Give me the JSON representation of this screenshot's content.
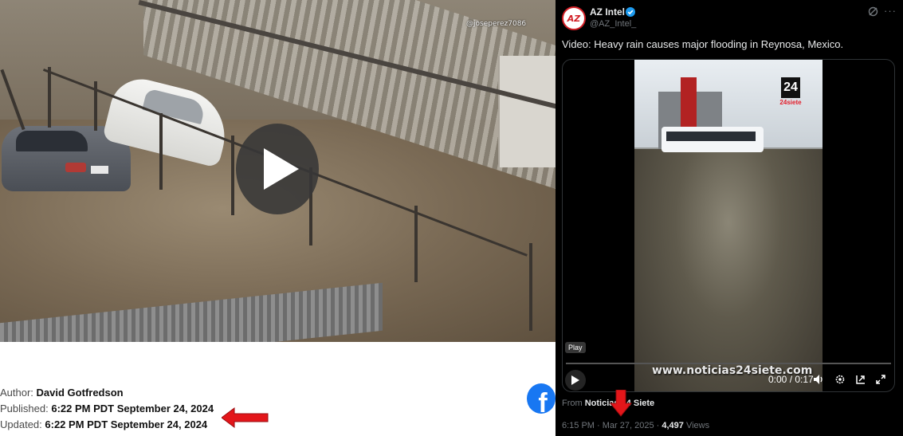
{
  "article": {
    "video_watermark": "@joseperez7086",
    "author_label": "Author:",
    "author_name": "David Gotfredson",
    "published_label": "Published:",
    "published_value": "6:22 PM PDT September 24, 2024",
    "updated_label": "Updated:",
    "updated_value": "6:22 PM PDT September 24, 2024",
    "share_icon": "facebook-icon"
  },
  "tweet": {
    "avatar_text": "AZ",
    "author_name": "AZ Intel",
    "handle": "@AZ_Intel_",
    "text": "Video: Heavy rain causes major flooding in Reynosa, Mexico.",
    "video": {
      "logo_number": "24",
      "logo_label": "24siete",
      "watermark": "www.noticias24siete.com",
      "play_badge": "Play",
      "time": "0:00 / 0:17"
    },
    "from_prefix": "From",
    "from_source": "Noticias 24 Siete",
    "timestamp": "6:15 PM · Mar 27, 2025 ·",
    "views_count": "4,497",
    "views_label": "Views"
  },
  "colors": {
    "arrow_red": "#e3161a",
    "facebook_blue": "#1877f2",
    "verified_blue": "#1d9bf0",
    "x_background": "#000000"
  }
}
